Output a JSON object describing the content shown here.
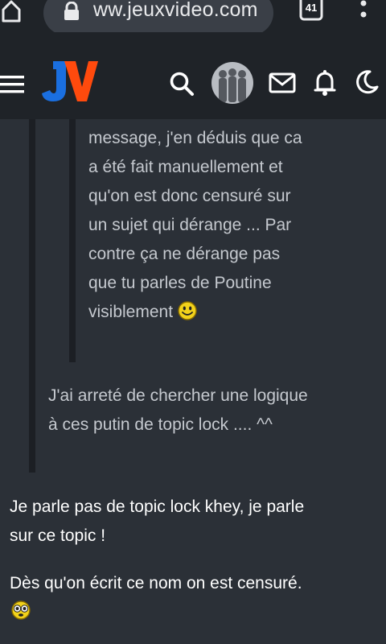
{
  "browser": {
    "url": "ww.jeuxvideo.com",
    "tab_count": "41"
  },
  "header": {
    "logo_text": "JV"
  },
  "quotes": {
    "inner_lines": [
      "message, j'en déduis que ca",
      "a été fait manuellement et",
      "qu'on est donc censuré sur",
      "un sujet qui dérange ... Par",
      "contre ça ne dérange pas",
      "que tu parles de Poutine",
      "visiblement"
    ],
    "outer_lines": [
      "J'ai arreté de chercher une logique",
      "à ces putin de topic lock .... ^^"
    ]
  },
  "post": {
    "line1": "Je parle pas de topic lock khey, je parle",
    "line2": "sur ce topic !",
    "line3": "Dès qu'on écrit ce nom on est censuré."
  },
  "colors": {
    "background": "#2b3037",
    "chrome": "#1f2328",
    "logo_blue": "#1a6fe0",
    "logo_orange": "#ff4a0d"
  }
}
